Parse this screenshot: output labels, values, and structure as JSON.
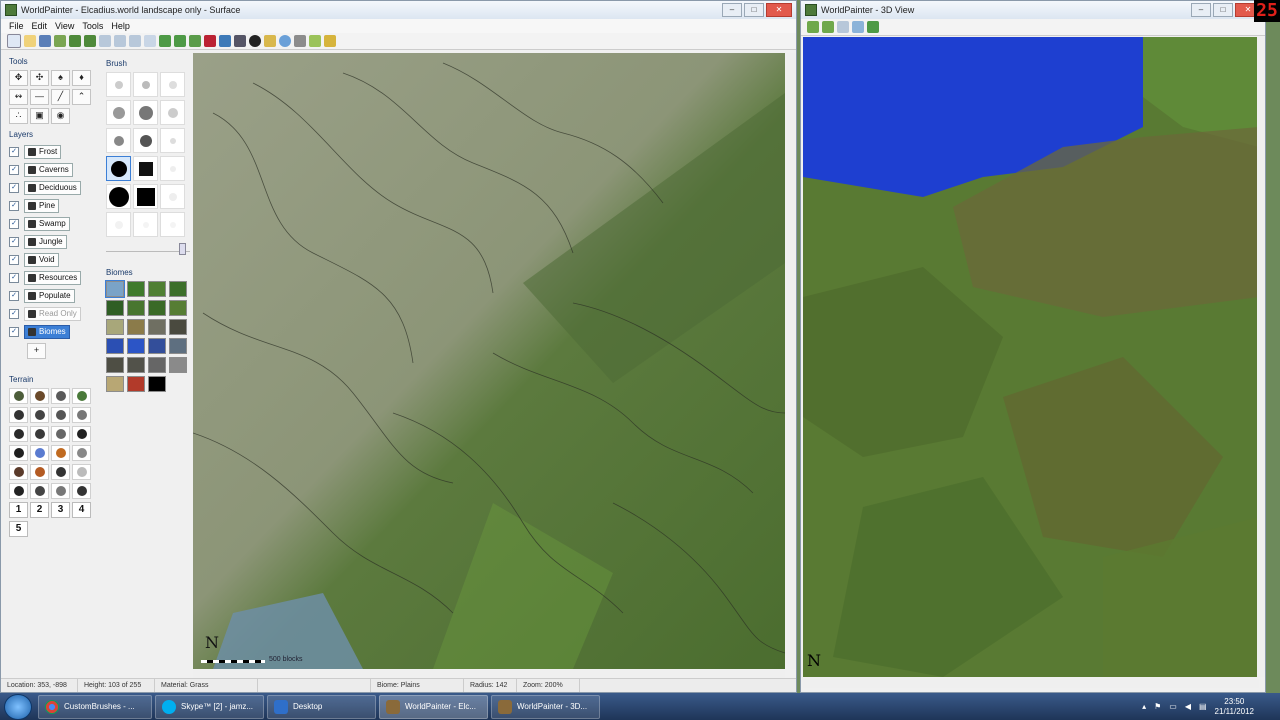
{
  "surface_window": {
    "title": "WorldPainter - Elcadius.world landscape only - Surface",
    "menu": [
      "File",
      "Edit",
      "View",
      "Tools",
      "Help"
    ],
    "tools_title": "Tools",
    "layers_title": "Layers",
    "layers": [
      {
        "label": "Frost",
        "checked": true
      },
      {
        "label": "Caverns",
        "checked": true
      },
      {
        "label": "Deciduous",
        "checked": true
      },
      {
        "label": "Pine",
        "checked": true
      },
      {
        "label": "Swamp",
        "checked": true
      },
      {
        "label": "Jungle",
        "checked": true
      },
      {
        "label": "Void",
        "checked": true
      },
      {
        "label": "Resources",
        "checked": true
      },
      {
        "label": "Populate",
        "checked": true
      },
      {
        "label": "Read Only",
        "checked": true
      },
      {
        "label": "Biomes",
        "checked": true
      }
    ],
    "add_layer": "+",
    "brush_title": "Brush",
    "biomes_title": "Biomes",
    "terrain_title": "Terrain",
    "terrain_numbers": [
      "1",
      "2",
      "3",
      "4",
      "5"
    ],
    "compass": "N",
    "scale_label": "500 blocks",
    "status": {
      "location": "Location: 353, -898",
      "height": "Height: 103 of 255",
      "material": "Material: Grass",
      "biome": "Biome: Plains",
      "radius": "Radius: 142",
      "zoom": "Zoom: 200%"
    }
  },
  "view3d_window": {
    "title": "WorldPainter - 3D View",
    "compass": "N"
  },
  "taskbar": {
    "items": [
      {
        "label": "CustomBrushes - ..."
      },
      {
        "label": "Skype™ [2] - jamz..."
      },
      {
        "label": "Desktop"
      },
      {
        "label": "WorldPainter - Elc..."
      },
      {
        "label": "WorldPainter - 3D..."
      }
    ],
    "time": "23:50",
    "date": "21/11/2012"
  },
  "overlay_badge": "25",
  "colors": {
    "terrain_green": "#5f7f3d",
    "highland_grey": "#8a9478",
    "water_blue": "#1e3fd0",
    "selected_blue": "#3c7fd6"
  }
}
